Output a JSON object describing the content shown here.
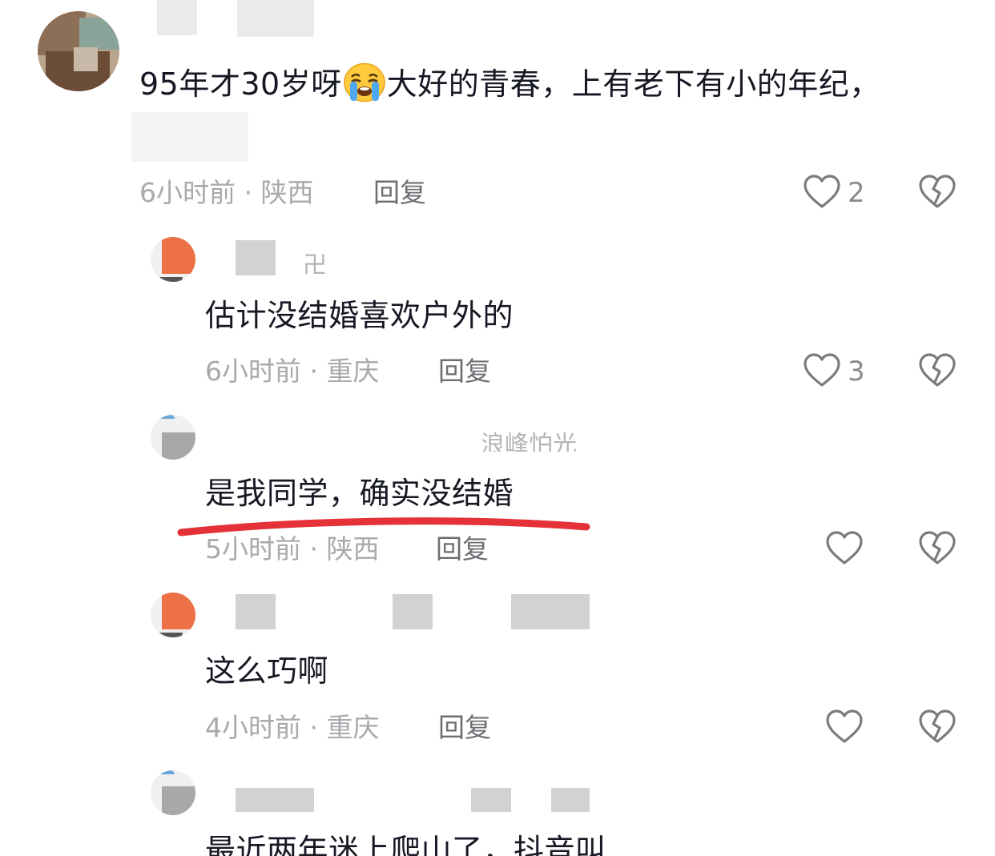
{
  "comments": [
    {
      "text_before_emoji": "95年才30岁呀",
      "emoji": "loudly-crying-face",
      "text_after_emoji": "大好的青春，上有老下有小的年纪，",
      "time": "6小时前",
      "location": "陕西",
      "reply_label": "回复",
      "like_count": "2"
    },
    {
      "username_fragment": "卍",
      "text": "估计没结婚喜欢户外的",
      "time": "6小时前",
      "location": "重庆",
      "reply_label": "回复",
      "like_count": "3"
    },
    {
      "username_fragment": "浪峰怕光",
      "text": "是我同学，确实没结婚",
      "time": "5小时前",
      "location": "陕西",
      "reply_label": "回复",
      "like_count": ""
    },
    {
      "text": "这么巧啊",
      "time": "4小时前",
      "location": "重庆",
      "reply_label": "回复",
      "like_count": ""
    },
    {
      "text": "最近两年迷上爬山了，抖音叫"
    }
  ],
  "separator": "·",
  "colors": {
    "text": "#161823",
    "meta": "#a9a9ae",
    "reply": "#6d6e73",
    "underline": "#e53238",
    "mosaic_orange": "#ec7146"
  },
  "icons": [
    "heart-outline-icon",
    "broken-heart-icon",
    "loudly-crying-face-emoji"
  ]
}
